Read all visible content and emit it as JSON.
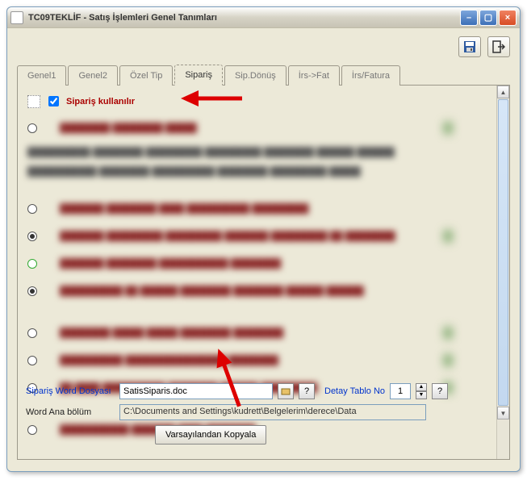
{
  "window": {
    "title": "TC09TEKLİF - Satış İşlemleri Genel Tanımları"
  },
  "toolbar": {
    "save_icon": "save-icon",
    "exit_icon": "exit-icon"
  },
  "tabs": [
    {
      "label": "Genel1"
    },
    {
      "label": "Genel2"
    },
    {
      "label": "Özel Tip"
    },
    {
      "label": "Sipariş",
      "active": true
    },
    {
      "label": "Sip.Dönüş"
    },
    {
      "label": "İrs->Fat"
    },
    {
      "label": "İrs/Fatura"
    }
  ],
  "siparis": {
    "checkbox_label": "Sipariş kullanılır",
    "checkbox_checked": true
  },
  "fields": {
    "word_dosyasi_label": "Sipariş Word Dosyası",
    "word_dosyasi_value": "SatisSiparis.doc",
    "browse_tooltip": "Gözat",
    "help_tooltip": "?",
    "detay_label": "Detay Tablo No",
    "detay_value": "1",
    "ana_bolum_label": "Word Ana bölüm",
    "ana_bolum_value": "C:\\Documents and Settings\\kudrett\\Belgelerim\\derece\\Data",
    "copy_button": "Varsayılandan Kopyala"
  }
}
